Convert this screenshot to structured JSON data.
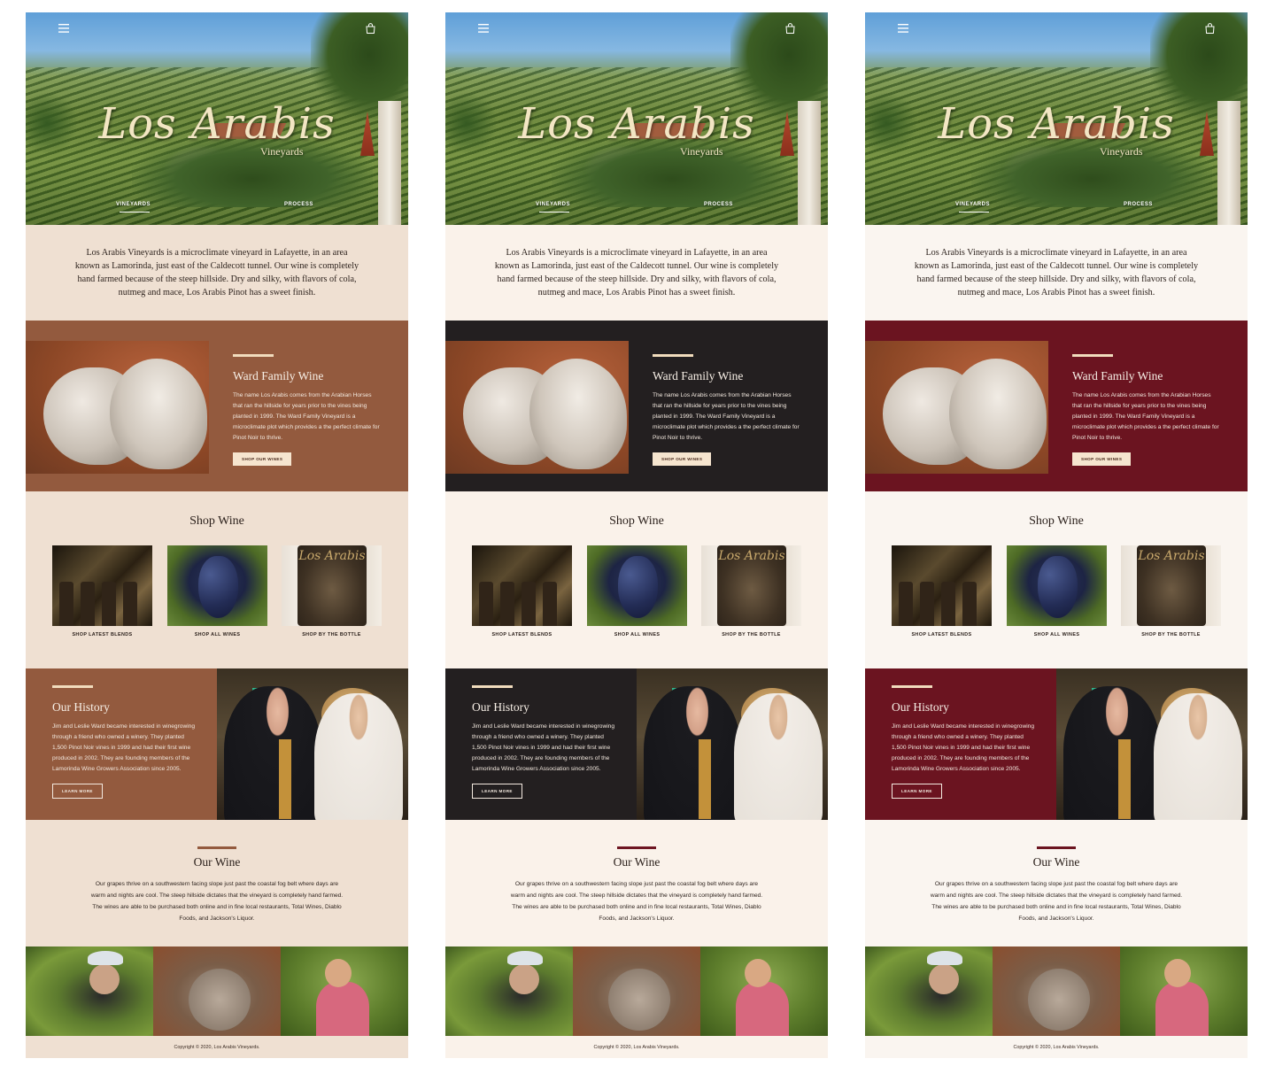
{
  "brand": {
    "logo_text": "Los Arabis",
    "logo_sub": "Vineyards"
  },
  "nav": {
    "link_1": "VINEYARDS",
    "link_2": "PROCESS"
  },
  "icons": {
    "menu": "hamburger-menu-icon",
    "cart": "shopping-bag-icon"
  },
  "intro": {
    "text": "Los Arabis Vineyards is a microclimate vineyard in Lafayette, in an area known as Lamorinda, just east of the Caldecott tunnel. Our wine is completely hand farmed because of the steep hillside. Dry and silky, with flavors of cola, nutmeg and mace, Los Arabis Pinot has a sweet finish."
  },
  "ward": {
    "title": "Ward Family Wine",
    "body": "The name Los Arabis comes from the Arabian Horses that ran the hillside for years prior to the vines being planted in 1999. The Ward Family Vineyard is a microclimate plot which provides a the perfect climate for Pinot Noir to thrive.",
    "button": "SHOP OUR WINES"
  },
  "shop": {
    "title": "Shop Wine",
    "cards": [
      {
        "label": "SHOP LATEST BLENDS"
      },
      {
        "label": "SHOP ALL WINES"
      },
      {
        "label": "SHOP BY THE BOTTLE"
      }
    ],
    "bottle_label_text": "Los Arabis"
  },
  "history": {
    "title": "Our History",
    "body": "Jim and Leslie Ward became interested in winegrowing through a friend who owned a winery. They planted 1,500 Pinot Noir vines in 1999 and had their first wine produced in 2002. They are founding members of the Lamorinda Wine Growers Association since 2005.",
    "button": "LEARN MORE"
  },
  "our_wine": {
    "title": "Our Wine",
    "body": "Our grapes thrive on a southwestern facing slope just past the coastal fog belt where days are warm and nights are cool. The steep hillside dictates that the vineyard is completely hand farmed. The wines are able to be purchased both online and in fine local restaurants, Total Wines, Diablo Foods, and Jackson's Liquor."
  },
  "footer": {
    "copyright": "Copyright © 2020, Los Arabis Vineyards."
  },
  "themes": [
    {
      "name": "brown",
      "bg_light": "#efe0d2",
      "accent_dark": "#935a3e",
      "accent_bar": "#935a3e"
    },
    {
      "name": "charcoal",
      "bg_light": "#faf2ea",
      "accent_dark": "#231f20",
      "accent_bar": "#6e1622"
    },
    {
      "name": "burgundy",
      "bg_light": "#faf5f0",
      "accent_dark": "#6b1420",
      "accent_bar": "#6b1420"
    }
  ]
}
